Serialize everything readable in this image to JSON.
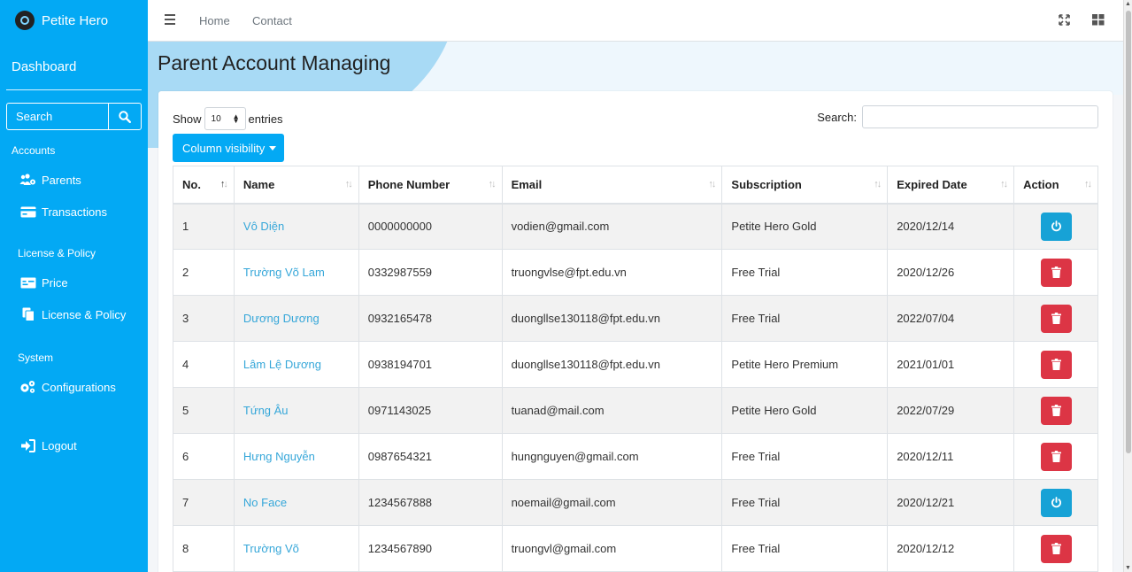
{
  "brand": {
    "name": "Petite Hero"
  },
  "sidebar": {
    "dashboard": "Dashboard",
    "search_label": "Search",
    "sections": [
      {
        "header": "Accounts",
        "items": [
          {
            "label": "Parents",
            "icon": "users-cog-icon"
          },
          {
            "label": "Transactions",
            "icon": "credit-card-icon"
          }
        ]
      },
      {
        "header": "License & Policy",
        "items": [
          {
            "label": "Price",
            "icon": "money-bill-icon"
          },
          {
            "label": "License & Policy",
            "icon": "copy-icon"
          }
        ]
      },
      {
        "header": "System",
        "items": [
          {
            "label": "Configurations",
            "icon": "cogs-icon"
          }
        ]
      }
    ],
    "logout": "Logout"
  },
  "topnav": {
    "home": "Home",
    "contact": "Contact"
  },
  "page": {
    "title": "Parent Account Managing"
  },
  "table_controls": {
    "show_label": "Show",
    "entries_value": "10",
    "entries_label": "entries",
    "search_label": "Search:",
    "column_visibility": "Column visibility"
  },
  "table": {
    "headers": [
      "No.",
      "Name",
      "Phone Number",
      "Email",
      "Subscription",
      "Expired Date",
      "Action"
    ],
    "rows": [
      {
        "no": "1",
        "name": "Vô Diện",
        "phone": "0000000000",
        "email": "vodien@gmail.com",
        "subscription": "Petite Hero Gold",
        "expired": "2020/12/14",
        "action": "activate"
      },
      {
        "no": "2",
        "name": "Trường Võ Lam",
        "phone": "0332987559",
        "email": "truongvlse@fpt.edu.vn",
        "subscription": "Free Trial",
        "expired": "2020/12/26",
        "action": "delete"
      },
      {
        "no": "3",
        "name": "Dương Dương",
        "phone": "0932165478",
        "email": "duongllse130118@fpt.edu.vn",
        "subscription": "Free Trial",
        "expired": "2022/07/04",
        "action": "delete"
      },
      {
        "no": "4",
        "name": "Lâm Lệ Dương",
        "phone": "0938194701",
        "email": "duongllse130118@fpt.edu.vn",
        "subscription": "Petite Hero Premium",
        "expired": "2021/01/01",
        "action": "delete"
      },
      {
        "no": "5",
        "name": "Tứng Âu",
        "phone": "0971143025",
        "email": "tuanad@mail.com",
        "subscription": "Petite Hero Gold",
        "expired": "2022/07/29",
        "action": "delete"
      },
      {
        "no": "6",
        "name": "Hưng Nguyễn",
        "phone": "0987654321",
        "email": "hungnguyen@gmail.com",
        "subscription": "Free Trial",
        "expired": "2020/12/11",
        "action": "delete"
      },
      {
        "no": "7",
        "name": "No Face",
        "phone": "1234567888",
        "email": "noemail@gmail.com",
        "subscription": "Free Trial",
        "expired": "2020/12/21",
        "action": "activate"
      },
      {
        "no": "8",
        "name": "Trường Võ",
        "phone": "1234567890",
        "email": "truongvl@gmail.com",
        "subscription": "Free Trial",
        "expired": "2020/12/12",
        "action": "delete"
      }
    ]
  },
  "colors": {
    "sidebar": "#03a9f4",
    "activate": "#17a2d6",
    "delete": "#dc3545",
    "link": "#36a7d9"
  }
}
